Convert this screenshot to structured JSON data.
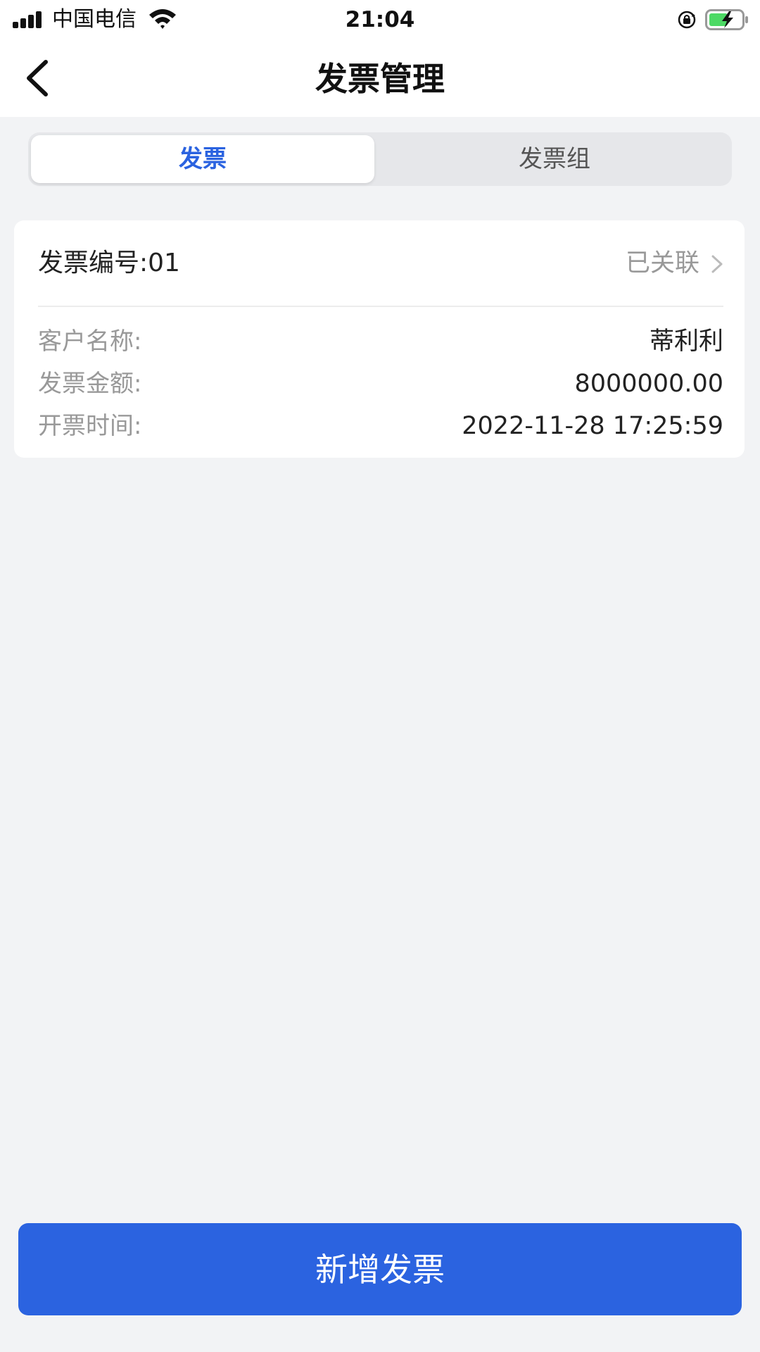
{
  "status_bar": {
    "carrier": "中国电信",
    "time": "21:04"
  },
  "nav": {
    "title": "发票管理"
  },
  "tabs": [
    {
      "label": "发票",
      "active": true
    },
    {
      "label": "发票组",
      "active": false
    }
  ],
  "invoice": {
    "number_label": "发票编号:01",
    "status": "已关联",
    "fields": [
      {
        "label": "客户名称:",
        "value": "蒂利利"
      },
      {
        "label": "发票金额:",
        "value": "8000000.00"
      },
      {
        "label": "开票时间:",
        "value": "2022-11-28 17:25:59"
      }
    ]
  },
  "actions": {
    "add_label": "新增发票"
  },
  "colors": {
    "accent": "#2b63e0",
    "background": "#f2f3f5",
    "battery_green": "#4cd964"
  }
}
